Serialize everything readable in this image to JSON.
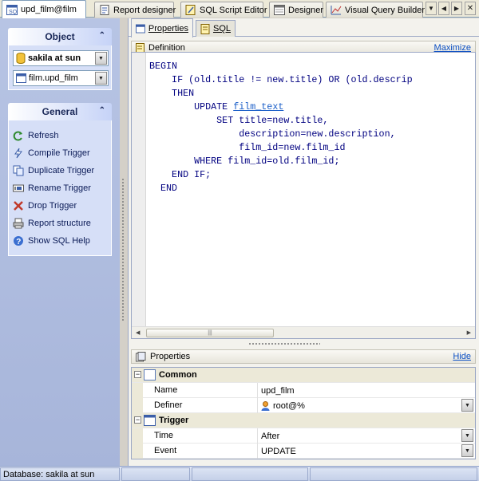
{
  "doc_tabs": [
    {
      "label": "upd_film@film",
      "icon": "trigger-icon",
      "active": true
    },
    {
      "label": "Report designer",
      "icon": "report-icon",
      "active": false
    },
    {
      "label": "SQL Script Editor",
      "icon": "sql-script-icon",
      "active": false
    },
    {
      "label": "Designer",
      "icon": "designer-icon",
      "active": false
    },
    {
      "label": "Visual Query Builder",
      "icon": "query-builder-icon",
      "active": false
    }
  ],
  "sidebar": {
    "object_group": {
      "title": "Object",
      "database": "sakila at sun",
      "trigger": "film.upd_film"
    },
    "general_group": {
      "title": "General",
      "items": [
        {
          "label": "Refresh",
          "icon": "refresh-icon"
        },
        {
          "label": "Compile Trigger",
          "icon": "compile-icon"
        },
        {
          "label": "Duplicate Trigger",
          "icon": "duplicate-icon"
        },
        {
          "label": "Rename Trigger",
          "icon": "rename-icon"
        },
        {
          "label": "Drop Trigger",
          "icon": "drop-icon"
        },
        {
          "label": "Report structure",
          "icon": "printer-icon"
        },
        {
          "label": "Show SQL Help",
          "icon": "help-icon"
        }
      ]
    }
  },
  "sub_tabs": [
    {
      "label": "Properties",
      "active": true
    },
    {
      "label": "SQL",
      "active": false
    }
  ],
  "definition": {
    "title": "Definition",
    "maximize_label": "Maximize",
    "code": {
      "l1": "BEGIN",
      "l2": "    IF (old.title != new.title) OR (old.descrip",
      "l3": "    THEN",
      "l4a": "        UPDATE ",
      "l4b": "film_text",
      "l5": "            SET title=new.title,",
      "l6": "                description=new.description,",
      "l7": "                film_id=new.film_id",
      "l8": "        WHERE film_id=old.film_id;",
      "l9": "    END IF;",
      "l10": "  END"
    }
  },
  "properties": {
    "title": "Properties",
    "hide_label": "Hide",
    "common": {
      "label": "Common",
      "name_label": "Name",
      "name_value": "upd_film",
      "definer_label": "Definer",
      "definer_value": "root@%"
    },
    "trigger": {
      "label": "Trigger",
      "time_label": "Time",
      "time_value": "After",
      "event_label": "Event",
      "event_value": "UPDATE"
    }
  },
  "status_bar": {
    "database": "Database: sakila at sun"
  }
}
